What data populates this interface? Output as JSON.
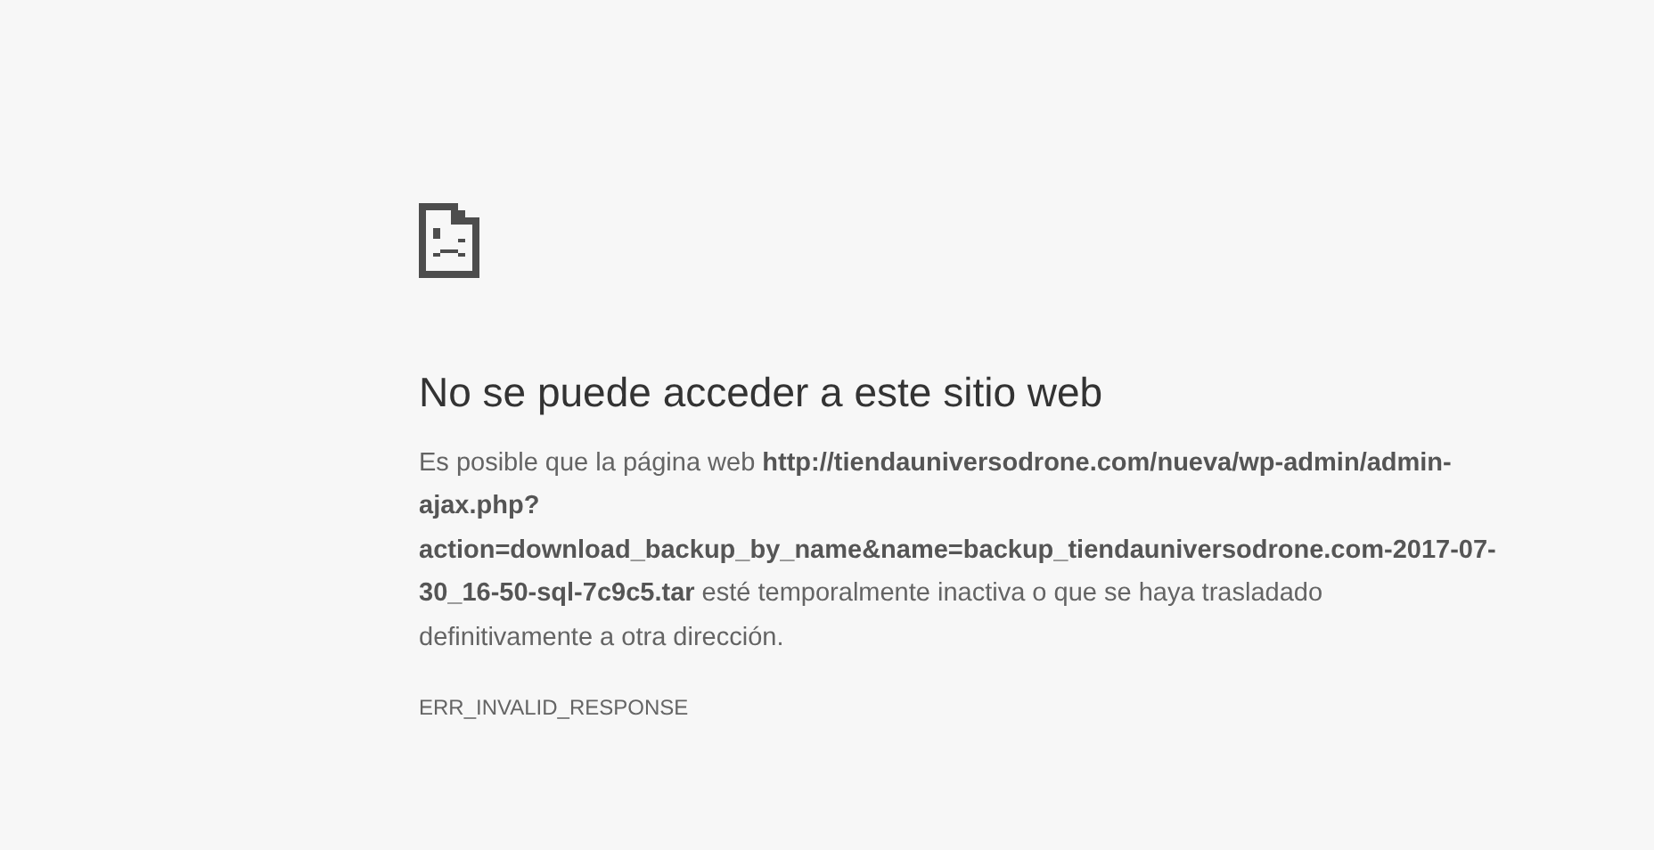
{
  "heading": "No se puede acceder a este sitio web",
  "message": "Es posible que la página web **http://tiendauniversodrone.com/nueva/wp-admin/admin-ajax.php?action=download_backup_by_name&name=backup_tiendauniversodrone.com-2017-07-30_16-50-sql-7c9c5.tar** esté temporalmente inactiva o que se haya trasladado definitivamente a otra dirección.",
  "error_code": "ERR_INVALID_RESPONSE"
}
